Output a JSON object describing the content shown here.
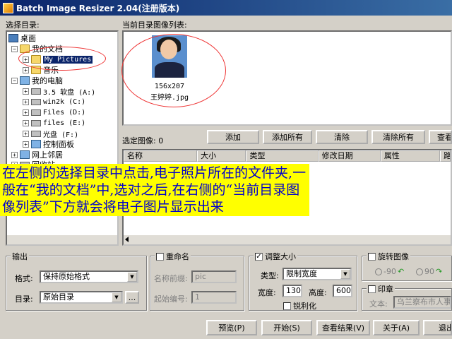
{
  "window": {
    "title": "Batch Image Resizer 2.04(注册版本)"
  },
  "labels": {
    "select_dir": "选择目录:",
    "current_list": "当前目录图像列表:",
    "selected_count": "选定图像: 0"
  },
  "tree": {
    "desktop": "桌面",
    "my_documents": "我的文档",
    "my_pictures": "My Pictures",
    "music": "音乐",
    "my_computer": "我的电脑",
    "floppy": "3.5 软盘 (A:)",
    "drive_c": "win2k (C:)",
    "drive_d": "Files (D:)",
    "drive_e": "files (E:)",
    "drive_f": "光盘 (F:)",
    "control_panel": "控制面板",
    "network": "网上邻居",
    "recycle": "回收站"
  },
  "image": {
    "dims": "156x207",
    "name": "王婷婷.jpg"
  },
  "buttons": {
    "add": "添加",
    "add_all": "添加所有",
    "remove": "清除",
    "remove_all": "清除所有",
    "view": "查看",
    "preview": "预览(P)",
    "start": "开始(S)",
    "results": "查看结果(V)",
    "about": "关于(A)",
    "exit": "退出",
    "browse": "..."
  },
  "columns": [
    "名称",
    "大小",
    "类型",
    "修改日期",
    "属性",
    "路"
  ],
  "annotation": "在左侧的选择目录中点击,电子照片所在的文件夹,一般在“我的文档”中,选对之后,在右侧的“当前目录图像列表”下方就会将电子图片显示出来",
  "output": {
    "title": "输出",
    "format_label": "格式:",
    "format_value": "保持原始格式",
    "dir_label": "目录:",
    "dir_value": "原始目录"
  },
  "rename": {
    "title": "重命名",
    "prefix_label": "名称前缀:",
    "prefix_value": "pic",
    "start_label": "起始编号:",
    "start_value": "1"
  },
  "resize": {
    "title": "调整大小",
    "type_label": "类型:",
    "type_value": "限制宽度",
    "width_label": "宽度:",
    "width_value": "130",
    "height_label": "高度:",
    "height_value": "600",
    "sharpen_label": "锐利化"
  },
  "rotate": {
    "title": "旋转图像",
    "opt1": "-90",
    "opt2": "90"
  },
  "stamp": {
    "title": "印章",
    "text_label": "文本:",
    "text_value": "乌兰察布市人事"
  },
  "colors": {
    "annotation_bg": "#ffff00",
    "annotation_text": "#0000cc",
    "oval": "#e33333",
    "titlebar": "#0a246a"
  }
}
